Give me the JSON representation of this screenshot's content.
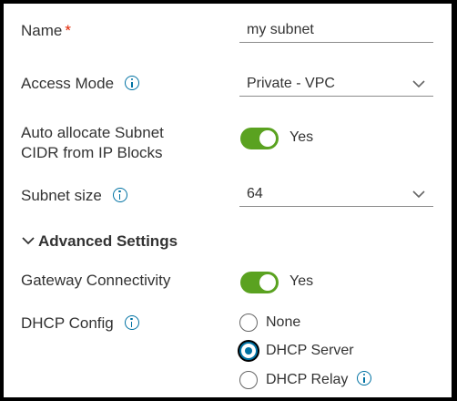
{
  "form": {
    "name": {
      "label": "Name",
      "required_mark": "*",
      "value": "my subnet"
    },
    "access_mode": {
      "label": "Access Mode",
      "value": "Private - VPC"
    },
    "auto_allocate": {
      "label_line1": "Auto allocate Subnet",
      "label_line2": "CIDR from IP Blocks",
      "toggle_text": "Yes",
      "on": true
    },
    "subnet_size": {
      "label": "Subnet size",
      "value": "64"
    },
    "advanced": {
      "title": "Advanced Settings"
    },
    "gateway": {
      "label": "Gateway Connectivity",
      "toggle_text": "Yes",
      "on": true
    },
    "dhcp": {
      "label": "DHCP Config",
      "options": [
        "None",
        "DHCP Server",
        "DHCP Relay"
      ],
      "selected": "DHCP Server"
    }
  },
  "colors": {
    "accent": "#0072a3",
    "toggle_on": "#5aa220",
    "required": "#e12200"
  },
  "icons": {
    "info": "info-circle-icon",
    "dropdown": "chevron-down-icon",
    "section": "chevron-down-icon"
  }
}
